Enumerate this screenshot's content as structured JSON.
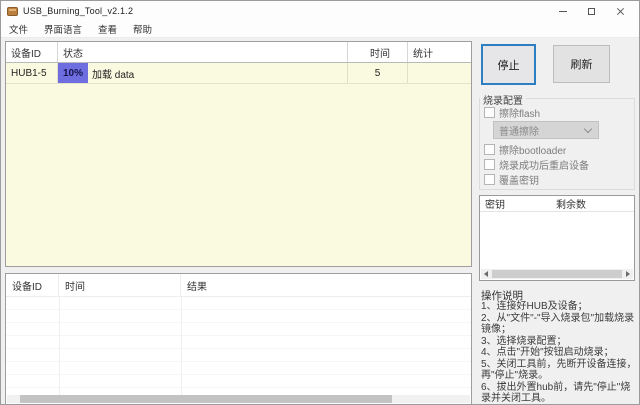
{
  "window": {
    "title": "USB_Burning_Tool_v2.1.2"
  },
  "menu": {
    "items": [
      "文件",
      "界面语言",
      "查看",
      "帮助"
    ]
  },
  "device_table": {
    "columns": [
      "设备ID",
      "状态",
      "时间",
      "统计"
    ],
    "rows": [
      {
        "device_id": "HUB1-5",
        "progress_label": "10%",
        "status_text": "加载 data",
        "time": "5",
        "stats": ""
      }
    ]
  },
  "actions": {
    "stop_label": "停止",
    "refresh_label": "刷新"
  },
  "burn_config": {
    "title": "烧录配置",
    "erase_flash_label": "擦除flash",
    "erase_mode_selected": "普通擦除",
    "erase_bootloader_label": "擦除bootloader",
    "reboot_after_success_label": "烧录成功后重启设备",
    "overwrite_key_label": "覆盖密钥"
  },
  "key_table": {
    "columns": [
      "密钥",
      "剩余数"
    ]
  },
  "instructions": {
    "title": "操作说明",
    "lines": [
      "1、连接好HUB及设备；",
      "2、从\"文件\"-\"导入烧录包\"加载烧录镜像；",
      "3、选择烧录配置；",
      "4、点击\"开始\"按钮启动烧录；",
      "5、关闭工具前，先断开设备连接，再\"停止\"烧录。",
      "6、拔出外置hub前，请先\"停止\"烧录并关闭工具。"
    ]
  },
  "result_table": {
    "columns": [
      "设备ID",
      "时间",
      "结果"
    ]
  },
  "colors": {
    "progress_fill": "#6e6ee0",
    "row_highlight": "#fafae1",
    "focus_border": "#2d7fc1",
    "app_icon": "#b98040",
    "window_bg": "#f0f0f0"
  }
}
